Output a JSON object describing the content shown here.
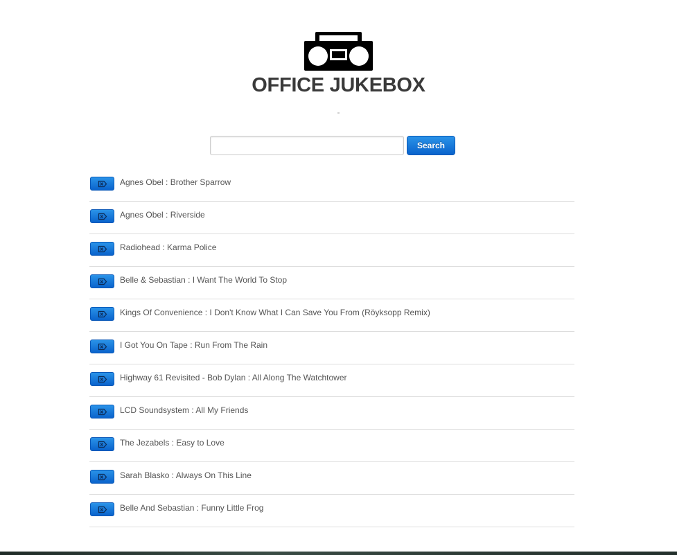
{
  "header": {
    "logo_icon": "boombox-icon",
    "title": "OFFICE JUKEBOX"
  },
  "now_playing": {
    "text": "-"
  },
  "search": {
    "value": "",
    "placeholder": "",
    "button_label": "Search"
  },
  "tracks": [
    {
      "title": "Agnes Obel : Brother Sparrow",
      "remove_icon": "remove-track-icon"
    },
    {
      "title": "Agnes Obel : Riverside",
      "remove_icon": "remove-track-icon"
    },
    {
      "title": "Radiohead : Karma Police",
      "remove_icon": "remove-track-icon"
    },
    {
      "title": "Belle & Sebastian : I Want The World To Stop",
      "remove_icon": "remove-track-icon"
    },
    {
      "title": "Kings Of Convenience : I Don't Know What I Can Save You From (Röyksopp Remix)",
      "remove_icon": "remove-track-icon"
    },
    {
      "title": "I Got You On Tape : Run From The Rain",
      "remove_icon": "remove-track-icon"
    },
    {
      "title": "Highway 61 Revisited - Bob Dylan : All Along The Watchtower",
      "remove_icon": "remove-track-icon"
    },
    {
      "title": "LCD Soundsystem : All My Friends",
      "remove_icon": "remove-track-icon"
    },
    {
      "title": "The Jezabels : Easy to Love",
      "remove_icon": "remove-track-icon"
    },
    {
      "title": "Sarah Blasko : Always On This Line",
      "remove_icon": "remove-track-icon"
    },
    {
      "title": "Belle And Sebastian : Funny Little Frog",
      "remove_icon": "remove-track-icon"
    }
  ],
  "colors": {
    "accent_blue": "#0a63cc",
    "title_gray": "#3a3a3a",
    "text_gray": "#555555",
    "divider": "#dddddd"
  }
}
